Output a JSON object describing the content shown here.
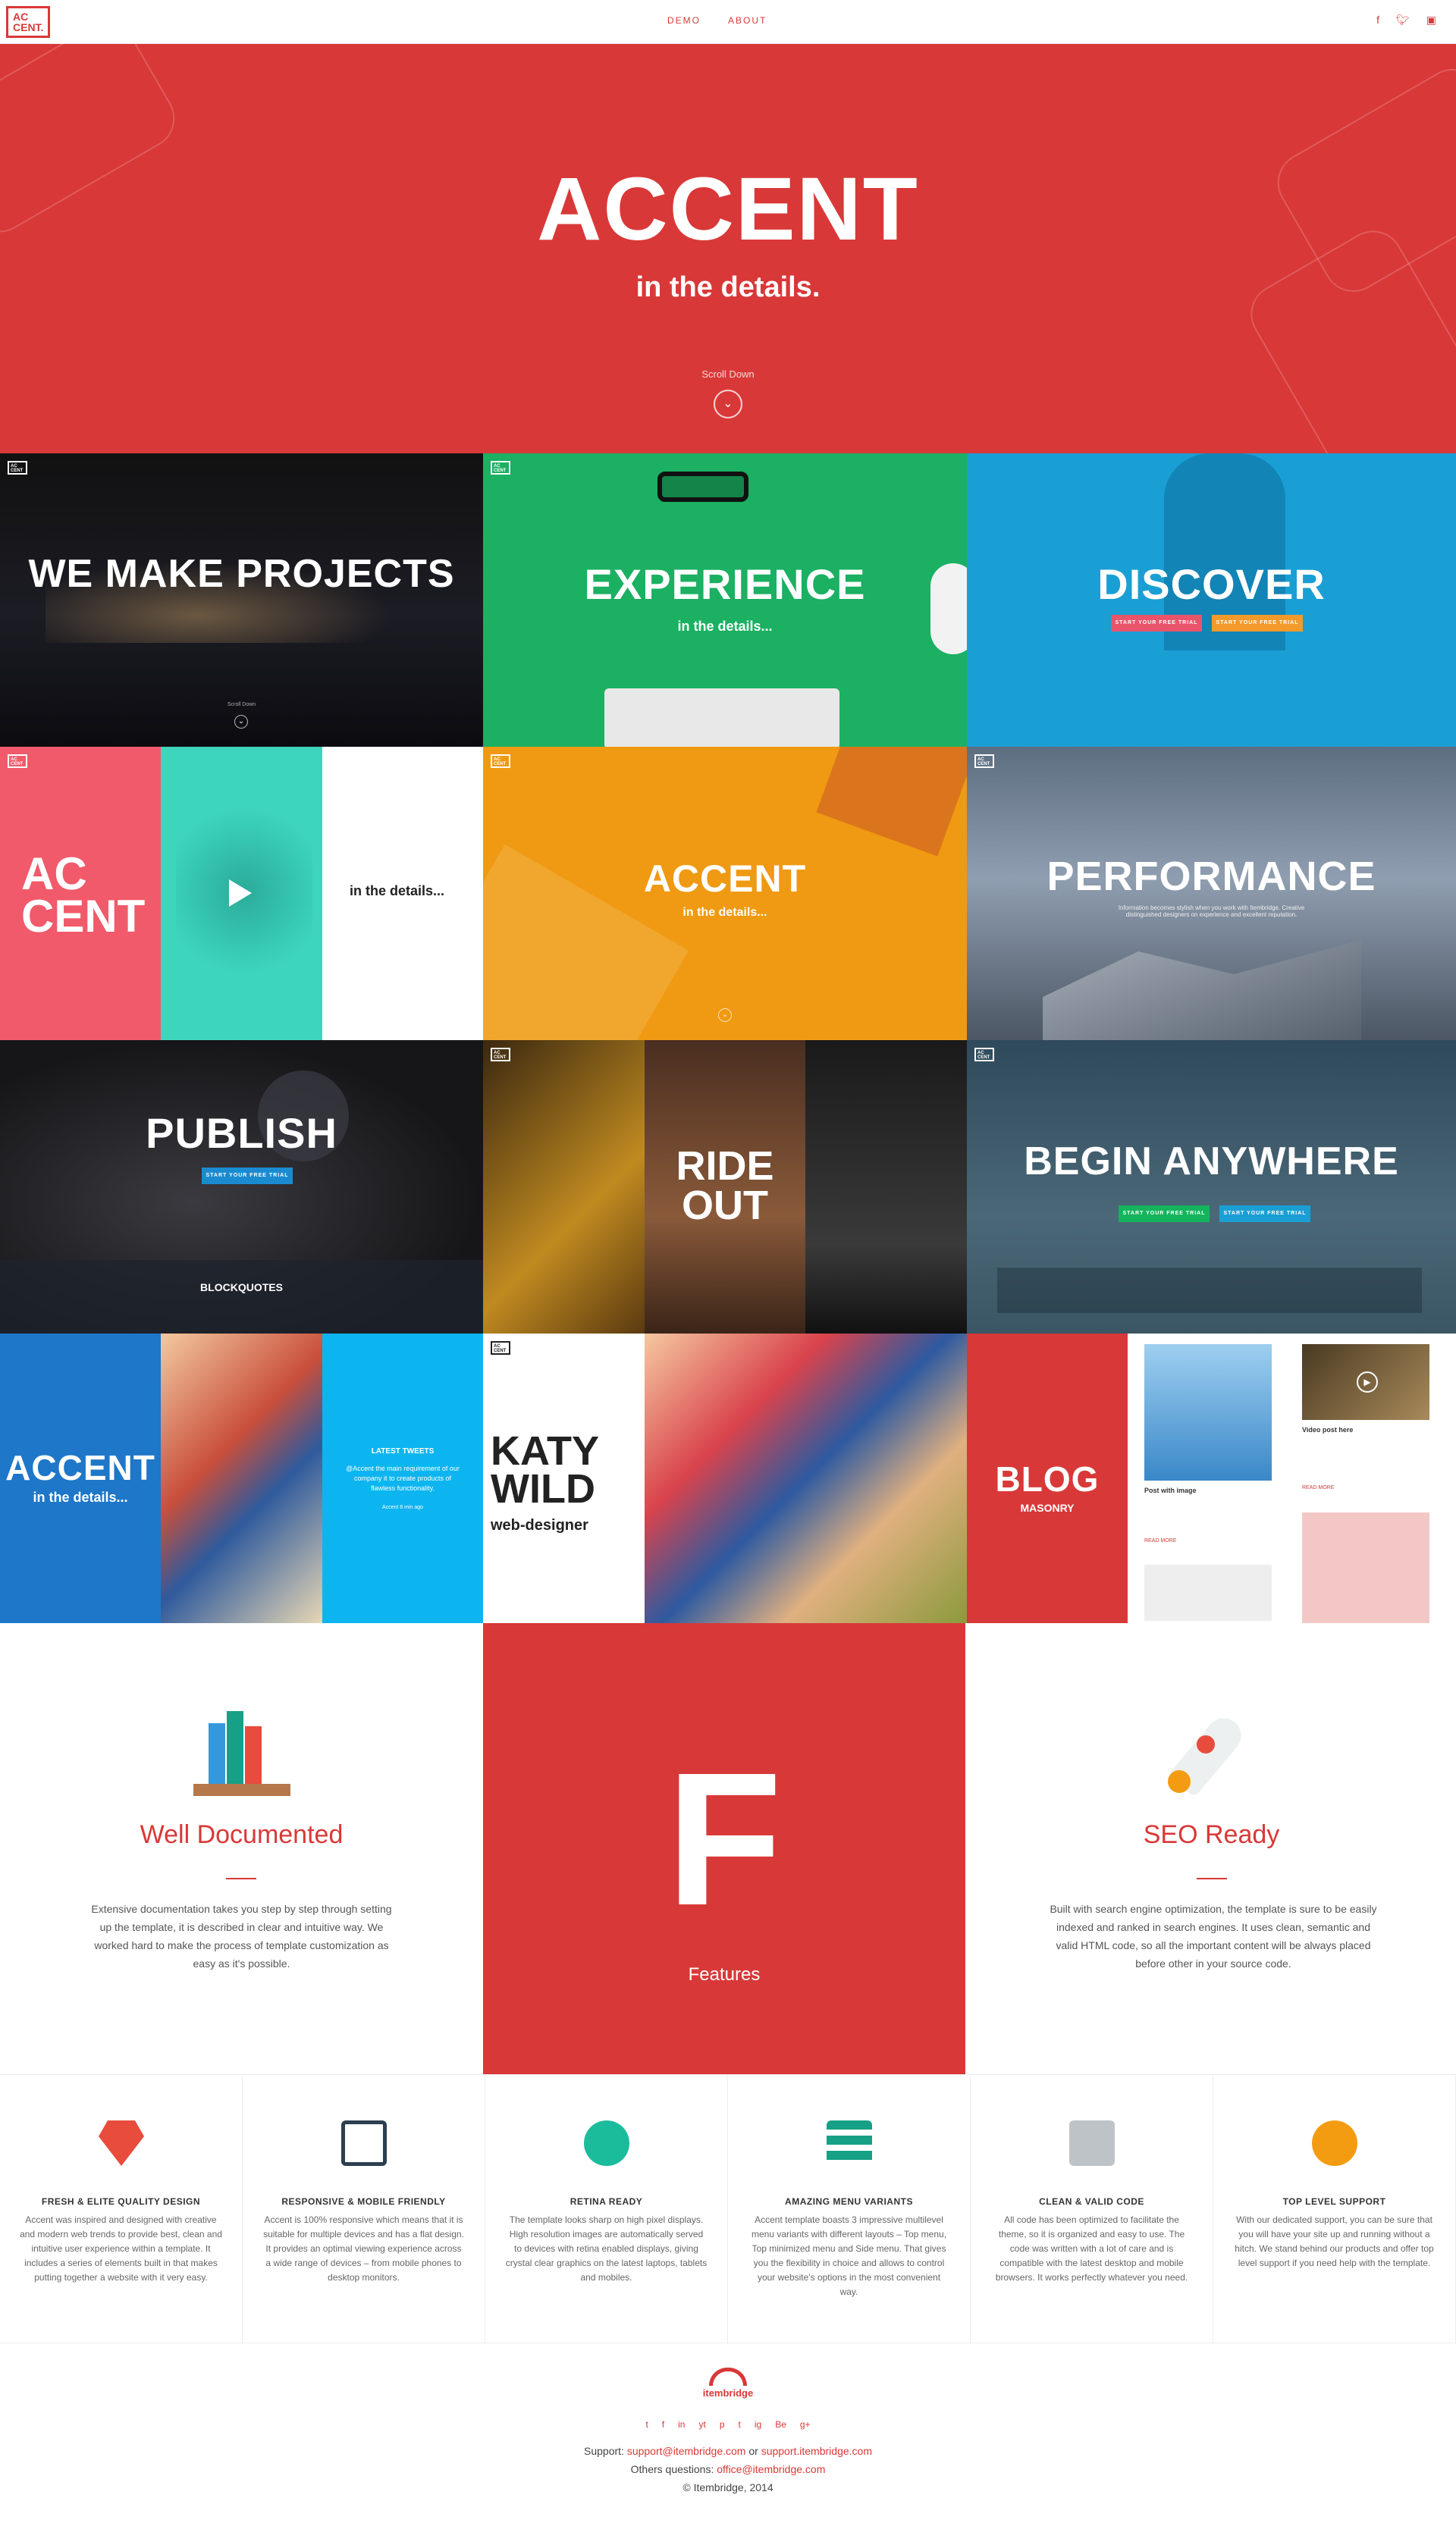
{
  "header": {
    "logo": "AC CENT.",
    "nav": [
      "DEMO",
      "ABOUT"
    ],
    "social": [
      "f",
      "t",
      "ig"
    ]
  },
  "hero": {
    "title": "ACCENT",
    "subtitle": "in the details.",
    "scroll": "Scroll Down",
    "scroll_icon": "chevron-down-icon"
  },
  "tiles": {
    "t1": {
      "title": "WE MAKE PROJECTS",
      "scroll": "Scroll Down"
    },
    "t2": {
      "title": "EXPERIENCE",
      "sub": "in the details..."
    },
    "t3": {
      "title": "DISCOVER",
      "btn1": "START YOUR FREE TRIAL",
      "btn2": "START YOUR FREE TRIAL"
    },
    "t4": {
      "title": "AC CENT",
      "sub": "in the details..."
    },
    "t5": {
      "title": "ACCENT",
      "sub": "in the details..."
    },
    "t6": {
      "title": "PERFORMANCE",
      "text": "Information becomes stylish when you work with Itembridge. Creative distinguished designers on experience and excellent reputation."
    },
    "t7": {
      "title": "PUBLISH",
      "btn": "START YOUR FREE TRIAL",
      "quotes": "BLOCKQUOTES"
    },
    "t8": {
      "title": "RIDE OUT"
    },
    "t9": {
      "title": "BEGIN ANYWHERE",
      "btn1": "START YOUR FREE TRIAL",
      "btn2": "START YOUR FREE TRIAL"
    },
    "t10": {
      "title": "ACCENT",
      "sub": "in the details...",
      "tweets_title": "LATEST TWEETS",
      "tweet": "@Accent the main requirement of our company it to create products of flawless functionality.",
      "tweet_meta": "Accent 8 min ago"
    },
    "t11": {
      "title": "KATY WILD",
      "sub": "web-designer"
    },
    "t12": {
      "title": "BLOG",
      "sub": "MASONRY",
      "post1": "Post with image",
      "post2": "Video post here",
      "read": "READ MORE"
    }
  },
  "features": {
    "left": {
      "title": "Well Documented",
      "text": "Extensive documentation takes you step by step through setting up the template, it is described in clear and intuitive way. We worked hard to make the process of template customization as easy as it's possible."
    },
    "center": {
      "letter": "F",
      "label": "Features"
    },
    "right": {
      "title": "SEO Ready",
      "text": "Built with search engine optimization, the template is sure to be easily indexed and ranked in search engines. It uses clean, semantic and valid HTML code, so all the important content will be always placed before other in your source code."
    }
  },
  "strip": [
    {
      "title": "FRESH & ELITE QUALITY DESIGN",
      "text": "Accent was inspired and designed with creative and modern web trends to provide best, clean and intuitive user experience within a template. It includes a series of elements built in that makes putting together a website with it very easy.",
      "icon": "diamond-icon",
      "color": "#e74c3c"
    },
    {
      "title": "RESPONSIVE & MOBILE FRIENDLY",
      "text": "Accent is 100% responsive which means that it is suitable for multiple devices and has a flat design. It provides an optimal viewing experience across a wide range of devices – from mobile phones to desktop monitors.",
      "icon": "presentation-icon",
      "color": "#2c3e50"
    },
    {
      "title": "RETINA READY",
      "text": "The template looks sharp on high pixel displays. High resolution images are automatically served to devices with retina enabled displays, giving crystal clear graphics on the latest laptops, tablets and mobiles.",
      "icon": "eye-icon",
      "color": "#1abc9c"
    },
    {
      "title": "AMAZING MENU VARIANTS",
      "text": "Accent template boasts 3 impressive multilevel menu variants with different layouts – Top menu, Top minimized menu and Side menu. That gives you the flexibility in choice and allows to control your website's options in the most convenient way.",
      "icon": "menu-icon",
      "color": "#16a085"
    },
    {
      "title": "CLEAN & VALID CODE",
      "text": "All code has been optimized to facilitate the theme, so it is organized and easy to use. The code was written with a lot of care and is compatible with the latest desktop and mobile browsers. It works perfectly whatever you need.",
      "icon": "keyboard-icon",
      "color": "#bdc3c7"
    },
    {
      "title": "TOP LEVEL SUPPORT",
      "text": "With our dedicated support, you can be sure that you will have your site up and running without a hitch. We stand behind our products and offer top level support if you need help with the template.",
      "icon": "medal-icon",
      "color": "#f39c12"
    }
  ],
  "footer": {
    "brand": "itembridge",
    "social": [
      "t",
      "f",
      "in",
      "yt",
      "p",
      "t",
      "ig",
      "Be",
      "g+"
    ],
    "support_label": "Support:",
    "support1": "support@itembridge.com",
    "or": "or",
    "support2": "support.itembridge.com",
    "others_label": "Others questions:",
    "others": "office@itembridge.com",
    "copy": "© Itembridge, 2014"
  }
}
